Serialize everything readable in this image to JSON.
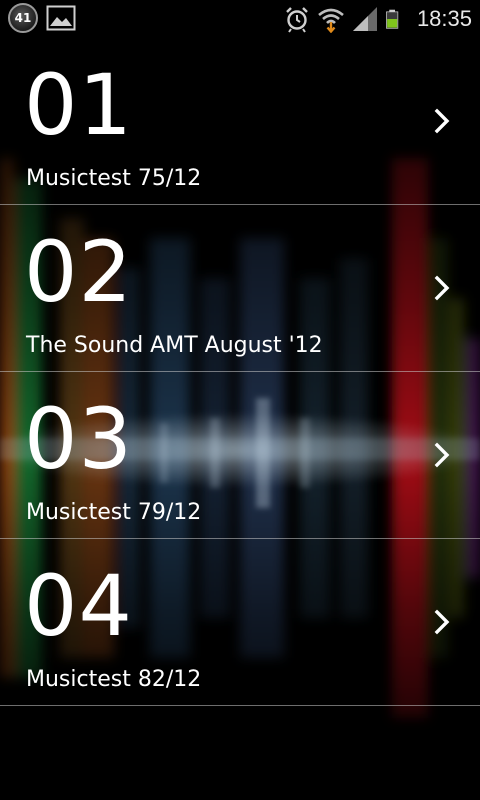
{
  "status_bar": {
    "notification_count": "41",
    "time": "18:35",
    "icons": [
      "notification-count-icon",
      "gallery-icon",
      "alarm-icon",
      "wifi-icon",
      "signal-icon",
      "battery-icon"
    ]
  },
  "items": [
    {
      "number": "01",
      "title": "Musictest 75/12"
    },
    {
      "number": "02",
      "title": "The Sound AMT August '12"
    },
    {
      "number": "03",
      "title": "Musictest 79/12"
    },
    {
      "number": "04",
      "title": "Musictest 82/12"
    }
  ],
  "colors": {
    "background": "#000000",
    "text": "#ffffff",
    "divider": "#c8c8c8",
    "battery": "#7fc31c",
    "visualizer_red": "#c0101a",
    "visualizer_green": "#1e8a3a",
    "visualizer_orange": "#d2691e",
    "visualizer_blue": "#3a6a9a"
  }
}
